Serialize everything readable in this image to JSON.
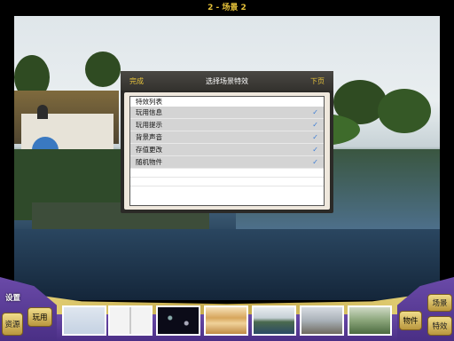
{
  "header": {
    "title": "2 - 场景 2"
  },
  "dialog": {
    "done_label": "完成",
    "title": "选择场景特效",
    "next_label": "下页",
    "list_header": "特效列表",
    "items": [
      {
        "label": "玩用信息",
        "checked": true
      },
      {
        "label": "玩用提示",
        "checked": true
      },
      {
        "label": "背景声音",
        "checked": true
      },
      {
        "label": "存值更改",
        "checked": true
      },
      {
        "label": "随机物件",
        "checked": true
      }
    ],
    "check_glyph": "✓"
  },
  "toolbar": {
    "settings_label": "设置",
    "resources_label": "资源",
    "play_label": "玩用",
    "objects_label": "物件",
    "scenes_label": "场景",
    "effects_label": "特效"
  },
  "thumbnails": [
    {
      "name": "blank-scene"
    },
    {
      "name": "open-book"
    },
    {
      "name": "starry-space"
    },
    {
      "name": "wooden-shelf"
    },
    {
      "name": "village-lake"
    },
    {
      "name": "rural-street"
    },
    {
      "name": "green-landscape"
    }
  ],
  "colors": {
    "accent": "#e6c23a",
    "check": "#3a7bd5",
    "toolbar_purple": "#5b3c96",
    "toolbar_gold": "#d8c266"
  }
}
